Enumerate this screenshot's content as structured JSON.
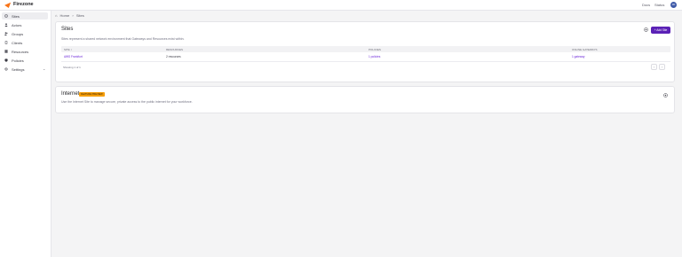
{
  "app": {
    "name": "Firezone"
  },
  "topbar": {
    "docs": "Docs",
    "support": "Status",
    "avatar_initials": "JD"
  },
  "sidebar": {
    "items": [
      {
        "label": "Sites",
        "icon": "sites-icon",
        "active": true
      },
      {
        "label": "Actors",
        "icon": "user-icon"
      },
      {
        "label": "Groups",
        "icon": "users-icon"
      },
      {
        "label": "Clients",
        "icon": "device-icon"
      },
      {
        "label": "Resources",
        "icon": "server-icon"
      },
      {
        "label": "Policies",
        "icon": "shield-icon"
      },
      {
        "label": "Settings",
        "icon": "gear-icon"
      }
    ]
  },
  "breadcrumb": {
    "home": "Home",
    "separator": "›",
    "current": "Sites"
  },
  "sites": {
    "title": "Sites",
    "description": "Sites represent a shared network environment that Gateways and Resources exist within.",
    "add_button": "+ Add Site",
    "columns": [
      "SITE ↕",
      "RESOURCES",
      "POLICIES",
      "ONLINE GATEWAYS"
    ],
    "rows": [
      {
        "site": "AWS Frankfurt",
        "resources": "2 resources",
        "policies": "1 policies",
        "gateways": "1 gateway"
      }
    ],
    "showing": "Showing 1 of 1",
    "prev": "‹",
    "next": "›"
  },
  "internet": {
    "title": "Internet",
    "badge": "FEATURE PREVIEW",
    "description": "Use the Internet Site to manage secure, private access to the public internet for your workforce."
  },
  "colors": {
    "accent": "#5b21b6",
    "link": "#6d28d9",
    "badge": "#f59e0b"
  }
}
